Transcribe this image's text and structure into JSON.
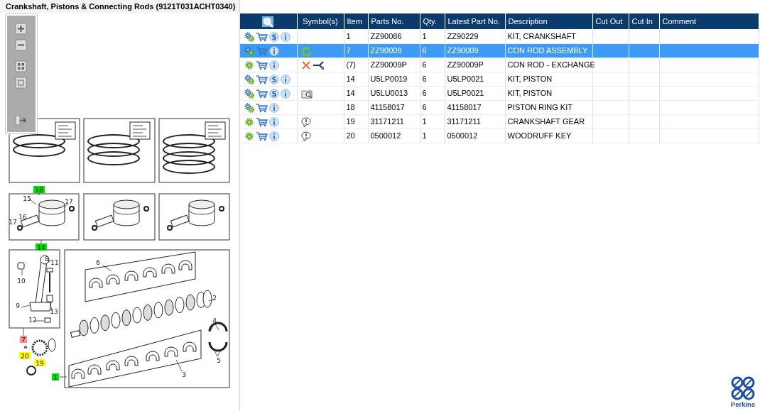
{
  "diagram": {
    "title": "Crankshaft, Pistons & Connecting Rods (9121T031ACHT0340)",
    "callouts": [
      {
        "label": "18",
        "color": "#00e000"
      },
      {
        "label": "14",
        "color": "#00e000"
      },
      {
        "label": "7",
        "color": "#ff8a8a"
      },
      {
        "label": "20",
        "color": "#ffff00"
      },
      {
        "label": "19",
        "color": "#ffff00"
      },
      {
        "label": "1",
        "color": "#00e000"
      },
      {
        "label": "15"
      },
      {
        "label": "17"
      },
      {
        "label": "16"
      },
      {
        "label": "17"
      },
      {
        "label": "8"
      },
      {
        "label": "11"
      },
      {
        "label": "10"
      },
      {
        "label": "9"
      },
      {
        "label": "13"
      },
      {
        "label": "12"
      },
      {
        "label": "6"
      },
      {
        "label": "2"
      },
      {
        "label": "4"
      },
      {
        "label": "5"
      },
      {
        "label": "3"
      }
    ]
  },
  "table": {
    "columns": [
      "Symbol(s)",
      "Item",
      "Parts No.",
      "Qty.",
      "Latest Part No.",
      "Description",
      "Cut Out",
      "Cut In",
      "Comment"
    ],
    "rows": [
      {
        "actions": [
          {
            "kind": "multi-gear"
          },
          {
            "kind": "cart"
          },
          {
            "kind": "supersession"
          },
          {
            "kind": "info"
          }
        ],
        "symbols": [],
        "item": "1",
        "part_no": "ZZ90086",
        "qty": "1",
        "latest_part_no": "ZZ90229",
        "description": "KIT, CRANKSHAFT",
        "selected": false
      },
      {
        "actions": [
          {
            "kind": "multi-gear"
          },
          {
            "kind": "cart"
          },
          {
            "kind": "info"
          }
        ],
        "symbols": [
          {
            "kind": "revision"
          }
        ],
        "item": "7",
        "part_no": "ZZ90009",
        "qty": "6",
        "latest_part_no": "ZZ90009",
        "description": "CON ROD ASSEMBLY",
        "selected": true
      },
      {
        "actions": [
          {
            "kind": "single-gear"
          },
          {
            "kind": "cart"
          },
          {
            "kind": "info"
          }
        ],
        "symbols": [
          {
            "kind": "cross"
          },
          {
            "kind": "branch"
          }
        ],
        "item": "(7)",
        "part_no": "ZZ90009P",
        "qty": "6",
        "latest_part_no": "ZZ90009P",
        "description": "CON ROD - EXCHANGE",
        "selected": false
      },
      {
        "actions": [
          {
            "kind": "multi-gear"
          },
          {
            "kind": "cart"
          },
          {
            "kind": "supersession"
          },
          {
            "kind": "info"
          }
        ],
        "symbols": [],
        "item": "14",
        "part_no": "U5LP0019",
        "qty": "6",
        "latest_part_no": "U5LP0021",
        "description": "KIT, PISTON",
        "selected": false
      },
      {
        "actions": [
          {
            "kind": "multi-gear"
          },
          {
            "kind": "cart"
          },
          {
            "kind": "supersession"
          },
          {
            "kind": "info"
          }
        ],
        "symbols": [
          {
            "kind": "book"
          }
        ],
        "item": "14",
        "part_no": "U5LU0013",
        "qty": "6",
        "latest_part_no": "U5LP0021",
        "description": "KIT, PISTON",
        "selected": false
      },
      {
        "actions": [
          {
            "kind": "multi-gear"
          },
          {
            "kind": "cart"
          },
          {
            "kind": "info"
          }
        ],
        "symbols": [],
        "item": "18",
        "part_no": "41158017",
        "qty": "6",
        "latest_part_no": "41158017",
        "description": "PISTON RING KIT",
        "selected": false
      },
      {
        "actions": [
          {
            "kind": "single-gear"
          },
          {
            "kind": "cart"
          },
          {
            "kind": "info"
          }
        ],
        "symbols": [
          {
            "kind": "note"
          }
        ],
        "item": "19",
        "part_no": "31171211",
        "qty": "1",
        "latest_part_no": "31171211",
        "description": "CRANKSHAFT GEAR",
        "selected": false
      },
      {
        "actions": [
          {
            "kind": "single-gear"
          },
          {
            "kind": "cart"
          },
          {
            "kind": "info"
          }
        ],
        "symbols": [
          {
            "kind": "note"
          }
        ],
        "item": "20",
        "part_no": "0500012",
        "qty": "1",
        "latest_part_no": "0500012",
        "description": "WOODRUFF KEY",
        "selected": false
      }
    ]
  },
  "logo": {
    "text": "Perkins"
  }
}
